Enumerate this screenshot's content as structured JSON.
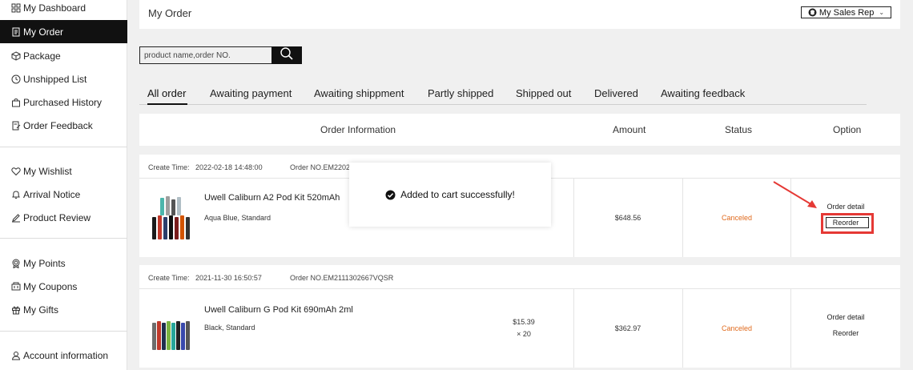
{
  "sidebar": {
    "items": [
      {
        "label": "My Dashboard",
        "icon": "grid-icon"
      },
      {
        "label": "My Order",
        "icon": "document-icon"
      },
      {
        "label": "Package",
        "icon": "box-icon"
      },
      {
        "label": "Unshipped List",
        "icon": "clock-icon"
      },
      {
        "label": "Purchased History",
        "icon": "bag-icon"
      },
      {
        "label": "Order Feedback",
        "icon": "feedback-icon"
      },
      {
        "label": "My Wishlist",
        "icon": "heart-icon"
      },
      {
        "label": "Arrival Notice",
        "icon": "bell-icon"
      },
      {
        "label": "Product Review",
        "icon": "pencil-icon"
      },
      {
        "label": "My Points",
        "icon": "medal-icon"
      },
      {
        "label": "My Coupons",
        "icon": "coupon-icon"
      },
      {
        "label": "My Gifts",
        "icon": "gift-icon"
      },
      {
        "label": "Account information",
        "icon": "user-icon"
      }
    ],
    "active_index": 1
  },
  "header": {
    "title": "My Order",
    "sales_rep_label": "My Sales Rep"
  },
  "search": {
    "placeholder": "product name,order NO."
  },
  "tabs": [
    {
      "label": "All order"
    },
    {
      "label": "Awaiting payment"
    },
    {
      "label": "Awaiting shippment"
    },
    {
      "label": "Partly shipped"
    },
    {
      "label": "Shipped out"
    },
    {
      "label": "Delivered"
    },
    {
      "label": "Awaiting feedback"
    }
  ],
  "table_header": {
    "order_information": "Order Information",
    "amount": "Amount",
    "status": "Status",
    "option": "Option"
  },
  "orders": [
    {
      "create_time_label": "Create Time:",
      "create_time": "2022-02-18 14:48:00",
      "order_no": "Order NO.EM2202",
      "product_name": "Uwell Caliburn A2 Pod Kit 520mAh",
      "variant": "Aqua Blue, Standard",
      "amount": "$648.56",
      "status": "Canceled",
      "option_detail": "Order detail",
      "option_reorder": "Reorder"
    },
    {
      "create_time_label": "Create Time:",
      "create_time": "2021-11-30 16:50:57",
      "order_no": "Order NO.EM2111302667VQSR",
      "product_name": "Uwell Caliburn G Pod Kit 690mAh 2ml",
      "variant": "Black, Standard",
      "unit_price": "$15.39",
      "quantity": "× 20",
      "amount": "$362.97",
      "status": "Canceled",
      "option_detail": "Order detail",
      "option_reorder": "Reorder"
    }
  ],
  "toast": {
    "message": "Added to cart successfully!"
  },
  "colors": {
    "accent_dark": "#111111",
    "status_canceled": "#e06a1d",
    "highlight_red": "#e53935"
  }
}
